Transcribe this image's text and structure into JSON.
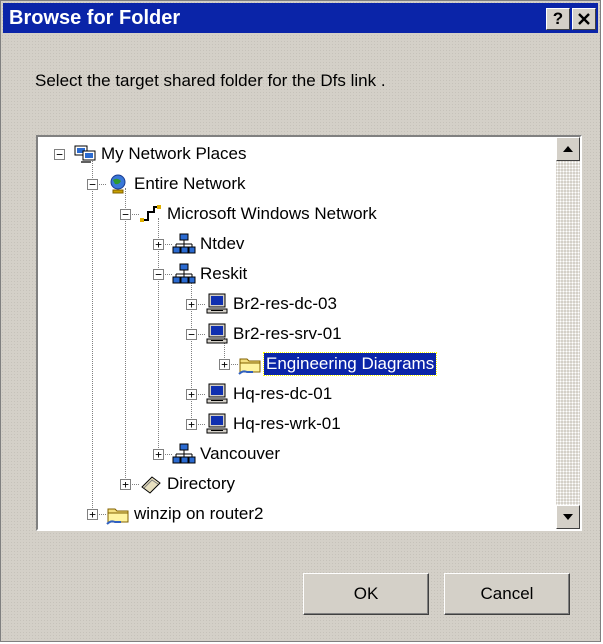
{
  "window": {
    "title": "Browse for Folder",
    "help_label": "?",
    "close_label": "✕"
  },
  "instruction": "Select the target shared folder for the Dfs link .",
  "tree": [
    {
      "label": "My Network Places",
      "icon": "network-places-icon",
      "expander": "−",
      "level": 0
    },
    {
      "label": "Entire Network",
      "icon": "globe-icon",
      "expander": "−",
      "level": 1
    },
    {
      "label": "Microsoft Windows Network",
      "icon": "network-icon",
      "expander": "−",
      "level": 2
    },
    {
      "label": "Ntdev",
      "icon": "domain-icon",
      "expander": "+",
      "level": 3
    },
    {
      "label": "Reskit",
      "icon": "domain-icon",
      "expander": "−",
      "level": 3
    },
    {
      "label": "Br2-res-dc-03",
      "icon": "computer-icon",
      "expander": "+",
      "level": 4
    },
    {
      "label": "Br2-res-srv-01",
      "icon": "computer-icon",
      "expander": "−",
      "level": 4
    },
    {
      "label": "Engineering Diagrams",
      "icon": "shared-folder-icon",
      "expander": "+",
      "level": 5,
      "selected": true
    },
    {
      "label": "Hq-res-dc-01",
      "icon": "computer-icon",
      "expander": "+",
      "level": 4
    },
    {
      "label": "Hq-res-wrk-01",
      "icon": "computer-icon",
      "expander": "+",
      "level": 4
    },
    {
      "label": "Vancouver",
      "icon": "domain-icon",
      "expander": "+",
      "level": 3
    },
    {
      "label": "Directory",
      "icon": "directory-icon",
      "expander": "+",
      "level": 2
    },
    {
      "label": "winzip on router2",
      "icon": "shared-folder-icon",
      "expander": "+",
      "level": 1
    }
  ],
  "buttons": {
    "ok": "OK",
    "cancel": "Cancel"
  },
  "colors": {
    "title_bar": "#0a24a8",
    "selection": "#0a24a8",
    "face": "#d4d0c8"
  }
}
